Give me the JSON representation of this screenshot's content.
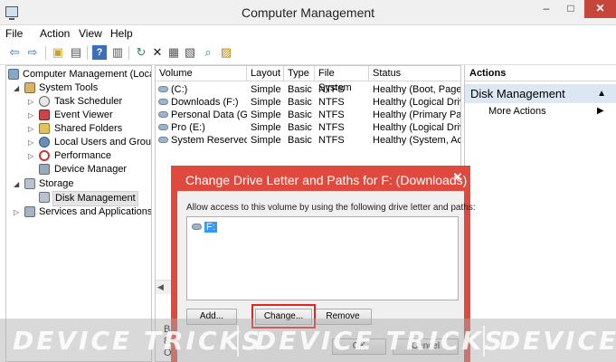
{
  "window": {
    "title": "Computer Management",
    "min_glyph": "–",
    "max_glyph": "□",
    "close_glyph": "✕"
  },
  "menu": [
    "File",
    "Action",
    "View",
    "Help"
  ],
  "toolbar": {
    "icons": [
      "back-arrow-icon",
      "forward-arrow-icon",
      "up-folder-icon",
      "show-hide-tree-icon",
      "help-icon",
      "properties-icon",
      "refresh-icon",
      "delete-icon",
      "connect-icon",
      "export-icon",
      "search-icon",
      "settings-icon"
    ],
    "glyphs": [
      "⇦",
      "⇨",
      "▣",
      "▤",
      "?",
      "▥",
      "↻",
      "✕",
      "▦",
      "▧",
      "⌕",
      "▨"
    ]
  },
  "tree": {
    "root": "Computer Management (Local",
    "system_tools": "System Tools",
    "task_scheduler": "Task Scheduler",
    "event_viewer": "Event Viewer",
    "shared_folders": "Shared Folders",
    "local_users": "Local Users and Groups",
    "performance": "Performance",
    "device_manager": "Device Manager",
    "storage": "Storage",
    "disk_management": "Disk Management",
    "services": "Services and Applications"
  },
  "volumes": {
    "headers": [
      "Volume",
      "Layout",
      "Type",
      "File System",
      "Status"
    ],
    "rows": [
      [
        "(C:)",
        "Simple",
        "Basic",
        "NTFS",
        "Healthy (Boot, Page F"
      ],
      [
        "Downloads (F:)",
        "Simple",
        "Basic",
        "NTFS",
        "Healthy (Logical Drive"
      ],
      [
        "Personal Data (G:)",
        "Simple",
        "Basic",
        "NTFS",
        "Healthy (Primary Part"
      ],
      [
        "Pro (E:)",
        "Simple",
        "Basic",
        "NTFS",
        "Healthy (Logical Drive"
      ],
      [
        "System Reserved",
        "Simple",
        "Basic",
        "NTFS",
        "Healthy (System, Acti"
      ]
    ],
    "lower_partial": [
      "Ba",
      "85",
      "Or"
    ]
  },
  "actions": {
    "header": "Actions",
    "section": "Disk Management",
    "more": "More Actions"
  },
  "dialog": {
    "title": "Change Drive Letter and Paths for F: (Downloads)",
    "message": "Allow access to this volume by using the following drive letter and paths:",
    "item": "F:",
    "add": "Add...",
    "change": "Change...",
    "remove": "Remove",
    "ok": "OK",
    "cancel": "Cancel"
  },
  "watermark": {
    "text1": "DEVICE TRICKS",
    "text2": "DEVICE TRICKS",
    "text3": "DEVICE"
  }
}
